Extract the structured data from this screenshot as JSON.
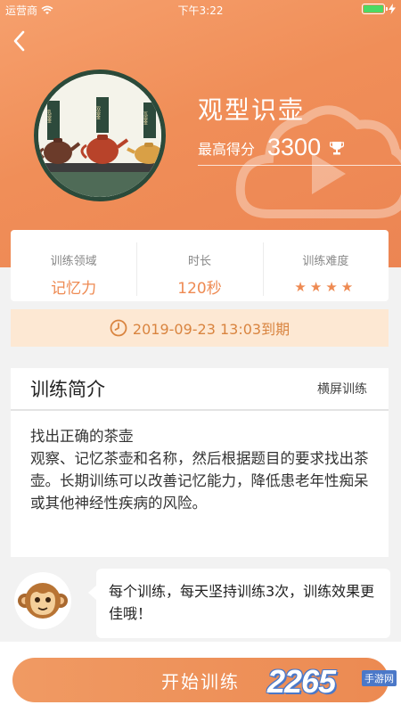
{
  "status_bar": {
    "carrier": "运营商",
    "time": "下午3:22"
  },
  "game": {
    "title": "观型识壶",
    "best_score_label": "最高得分",
    "best_score": "3300",
    "image_tags": [
      "乳壶金",
      "双壶金",
      "瓦壶金"
    ]
  },
  "info": {
    "domain_label": "训练领域",
    "domain_value": "记忆力",
    "duration_label": "时长",
    "duration_value": "120秒",
    "difficulty_label": "训练难度",
    "difficulty_stars": 4,
    "difficulty_text": "★★★★"
  },
  "expiry": {
    "text": "2019-09-23 13:03到期"
  },
  "intro": {
    "title": "训练简介",
    "mode": "横屏训练",
    "lines": [
      "找出正确的茶壶",
      "观察、记忆茶壶和名称，然后根据题目的要求找出茶壶。长期训练可以改善记忆能力，降低患老年性痴呆或其他神经性疾病的风险。"
    ]
  },
  "tip": {
    "text": "每个训练，每天坚持训练3次，训练效果更佳哦！"
  },
  "start_button": {
    "label": "开始训练"
  },
  "watermark": {
    "number": "2265",
    "suffix": "手游网"
  },
  "colors": {
    "accent": "#ee8a52",
    "hero": "#f08e58",
    "expiry_bg": "#fde8d3"
  }
}
